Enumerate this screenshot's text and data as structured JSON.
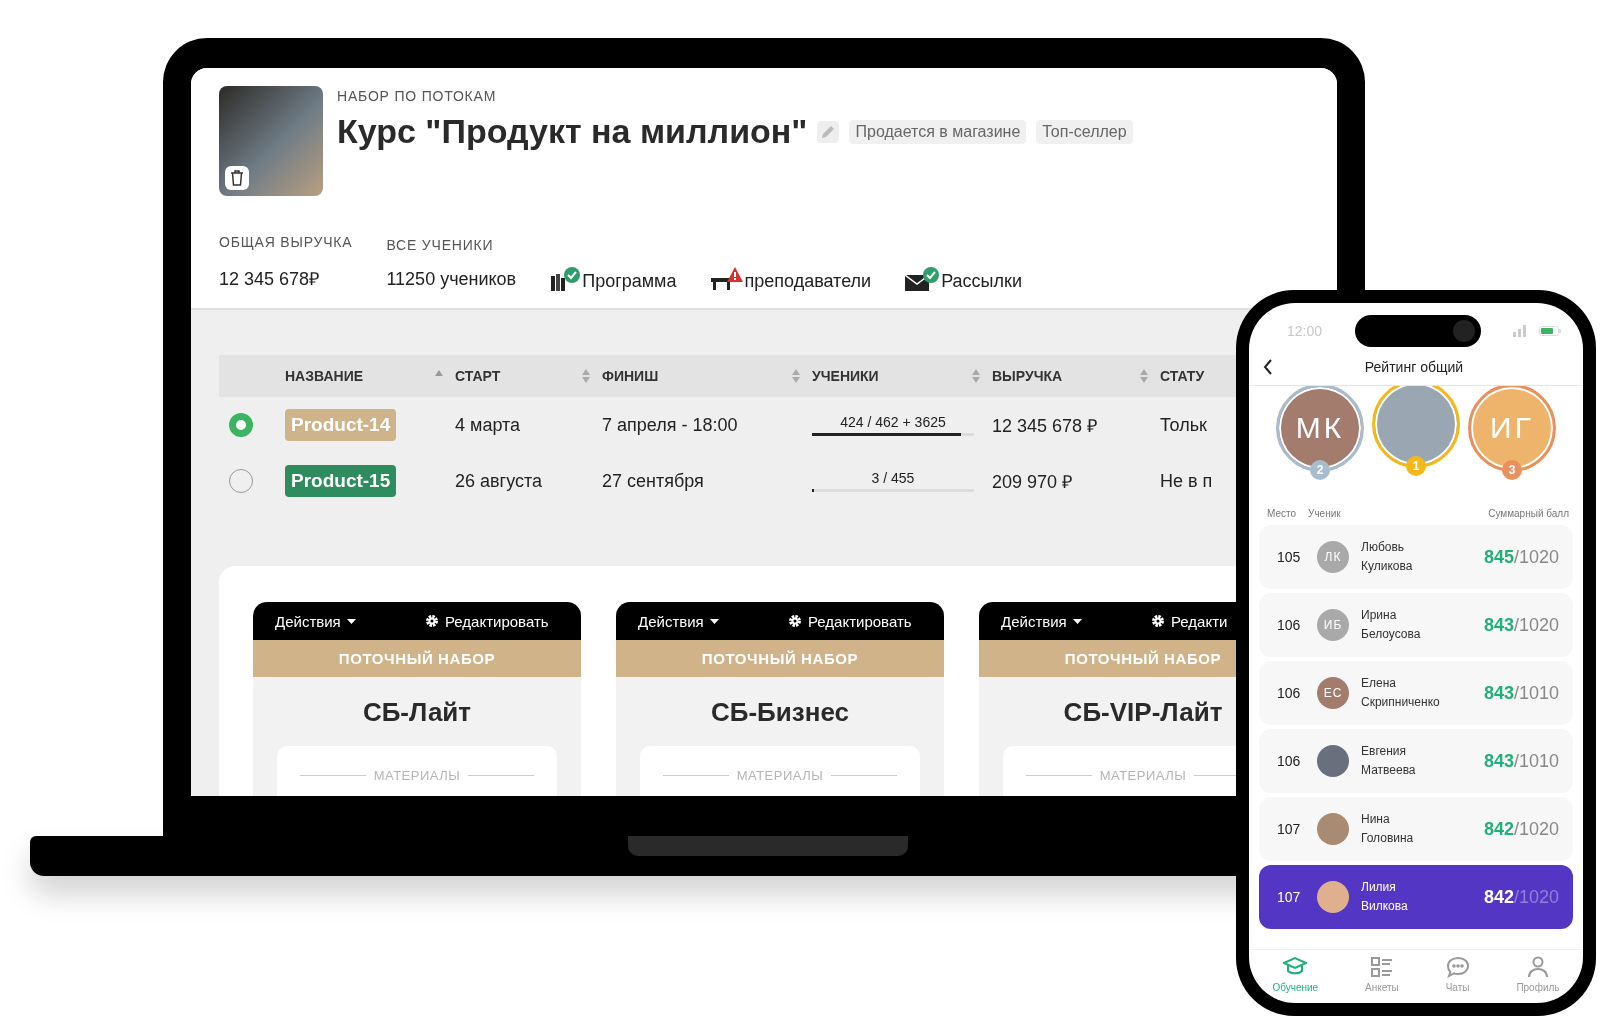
{
  "course": {
    "category": "НАБОР ПО ПОТОКАМ",
    "title": "Курс \"Продукт на миллион\"",
    "tags": [
      "Продается в магазине",
      "Топ-селлер"
    ]
  },
  "stats": [
    {
      "label": "ОБЩАЯ ВЫРУЧКА",
      "value": "12 345 678₽"
    },
    {
      "label": "ВСЕ УЧЕНИКИ",
      "value": "11250 учеников"
    }
  ],
  "sections": [
    {
      "kind": "books",
      "label": "Программа",
      "done": true
    },
    {
      "kind": "desk",
      "label": "преподаватели",
      "done": false
    },
    {
      "kind": "mail",
      "label": "Рассылки",
      "done": true
    }
  ],
  "table": {
    "columns": [
      {
        "label": "НАЗВАНИЕ",
        "sorted": true
      },
      {
        "label": "СТАРТ",
        "sorted": false
      },
      {
        "label": "ФИНИШ",
        "sorted": false
      },
      {
        "label": "УЧЕНИКИ",
        "sorted": false
      },
      {
        "label": "ВЫРУЧКА",
        "sorted": false
      },
      {
        "label": "СТАТУ"
      }
    ],
    "rows": [
      {
        "selected": true,
        "name": "Product-14",
        "color": "#cfb38a",
        "start": "4 марта",
        "finish": "7 апреля - 18:00",
        "students": "424 / 462 + 3625",
        "level": 0.92,
        "revenue": "12 345 678 ₽",
        "status": "Тольк"
      },
      {
        "selected": false,
        "name": "Product-15",
        "color": "#2f8c5e",
        "start": "26 августа",
        "finish": "27 сентября",
        "students": "3 / 455",
        "level": 0.01,
        "revenue": "209 970 ₽",
        "status": "Не в п"
      }
    ]
  },
  "cards": [
    {
      "actions": "Действия",
      "edit": "Редактировать",
      "type": "ПОТОЧНЫЙ НАБОР",
      "title": "СБ-Лайт",
      "section": "МАТЕРИАЛЫ"
    },
    {
      "actions": "Действия",
      "edit": "Редактировать",
      "type": "ПОТОЧНЫЙ НАБОР",
      "title": "СБ-Бизнес",
      "section": "МАТЕРИАЛЫ"
    },
    {
      "actions": "Действия",
      "edit": "Редакти",
      "type": "ПОТОЧНЫЙ НАБОР",
      "title": "СБ-VIP-Лайт",
      "section": "МАТЕРИАЛЫ"
    }
  ],
  "phone": {
    "time": "12:00",
    "title": "Рейтинг общий",
    "podium": [
      {
        "kind": "initials",
        "initials": "МК",
        "color": "#a47c6e",
        "place": "2"
      },
      {
        "kind": "photo",
        "color": "#9aa7b3",
        "place": "1"
      },
      {
        "kind": "initials",
        "initials": "ИГ",
        "color": "#efb46b",
        "place": "3"
      }
    ],
    "columns": [
      "Место",
      "Ученик",
      "Суммарный балл"
    ],
    "rows": [
      {
        "place": "105",
        "kind": "initials",
        "initials": "ЛК",
        "color": "#a9a9a9",
        "first": "Любовь",
        "last": "Куликова",
        "score": "845",
        "max": "/1020",
        "current": false
      },
      {
        "place": "106",
        "kind": "initials",
        "initials": "ИБ",
        "color": "#a9a9a9",
        "first": "Ирина",
        "last": "Белоусова",
        "score": "843",
        "max": "/1020",
        "current": false
      },
      {
        "place": "106",
        "kind": "initials",
        "initials": "ЕС",
        "color": "#a47c6e",
        "first": "Елена",
        "last": "Скрипниченко",
        "score": "843",
        "max": "/1010",
        "current": false
      },
      {
        "place": "106",
        "kind": "photo",
        "color": "#6a6f7e",
        "first": "Евгения",
        "last": "Матвеева",
        "score": "843",
        "max": "/1010",
        "current": false
      },
      {
        "place": "107",
        "kind": "photo",
        "color": "#a98a72",
        "first": "Нина",
        "last": "Головина",
        "score": "842",
        "max": "/1020",
        "current": false
      },
      {
        "place": "107",
        "kind": "photo",
        "color": "#e0b08e",
        "first": "Лилия",
        "last": "Вилкова",
        "score": "842",
        "max": "/1020",
        "current": true
      }
    ],
    "tabs": [
      {
        "kind": "learn",
        "label": "Обучение",
        "selected": true
      },
      {
        "kind": "forms",
        "label": "Анкеты",
        "selected": false
      },
      {
        "kind": "chat",
        "label": "Чаты",
        "selected": false
      },
      {
        "kind": "profile",
        "label": "Профиль",
        "selected": false
      }
    ]
  }
}
